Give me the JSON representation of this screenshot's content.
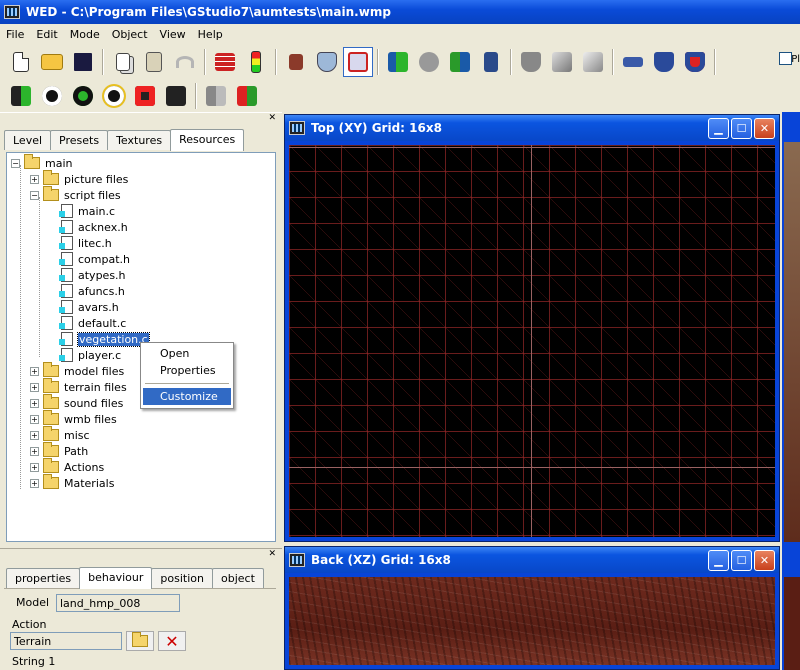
{
  "window": {
    "title": "WED - C:\\Program Files\\GStudio7\\aumtests\\main.wmp"
  },
  "menu": [
    "File",
    "Edit",
    "Mode",
    "Object",
    "View",
    "Help"
  ],
  "toolbar_checkbox_label": "Pl",
  "left_tabs": [
    "Level",
    "Presets",
    "Textures",
    "Resources"
  ],
  "left_active_tab": "Resources",
  "tree": {
    "root": "main",
    "folders_top": [
      "picture files",
      "script files"
    ],
    "script_files": [
      "main.c",
      "acknex.h",
      "litec.h",
      "compat.h",
      "atypes.h",
      "afuncs.h",
      "avars.h",
      "default.c",
      "vegetation.c",
      "player.c"
    ],
    "selected": "vegetation.c",
    "folders_bottom": [
      "model files",
      "terrain files",
      "sound files",
      "wmb files",
      "misc",
      "Path",
      "Actions",
      "Materials"
    ]
  },
  "context_menu": {
    "items": [
      "Open",
      "Properties"
    ],
    "highlighted": "Customize"
  },
  "bottom_tabs": [
    "properties",
    "behaviour",
    "position",
    "object"
  ],
  "bottom_active_tab": "behaviour",
  "props": {
    "model_label": "Model",
    "model_value": "land_hmp_008",
    "action_label": "Action",
    "action_value": "Terrain",
    "string_label": "String 1"
  },
  "views": {
    "top": {
      "title": "Top (XY) Grid: 16x8"
    },
    "back": {
      "title": "Back (XZ) Grid: 16x8"
    }
  },
  "colors": {
    "title_blue": "#0a4bd8",
    "grid_red": "#962828",
    "selection": "#316ac5"
  }
}
